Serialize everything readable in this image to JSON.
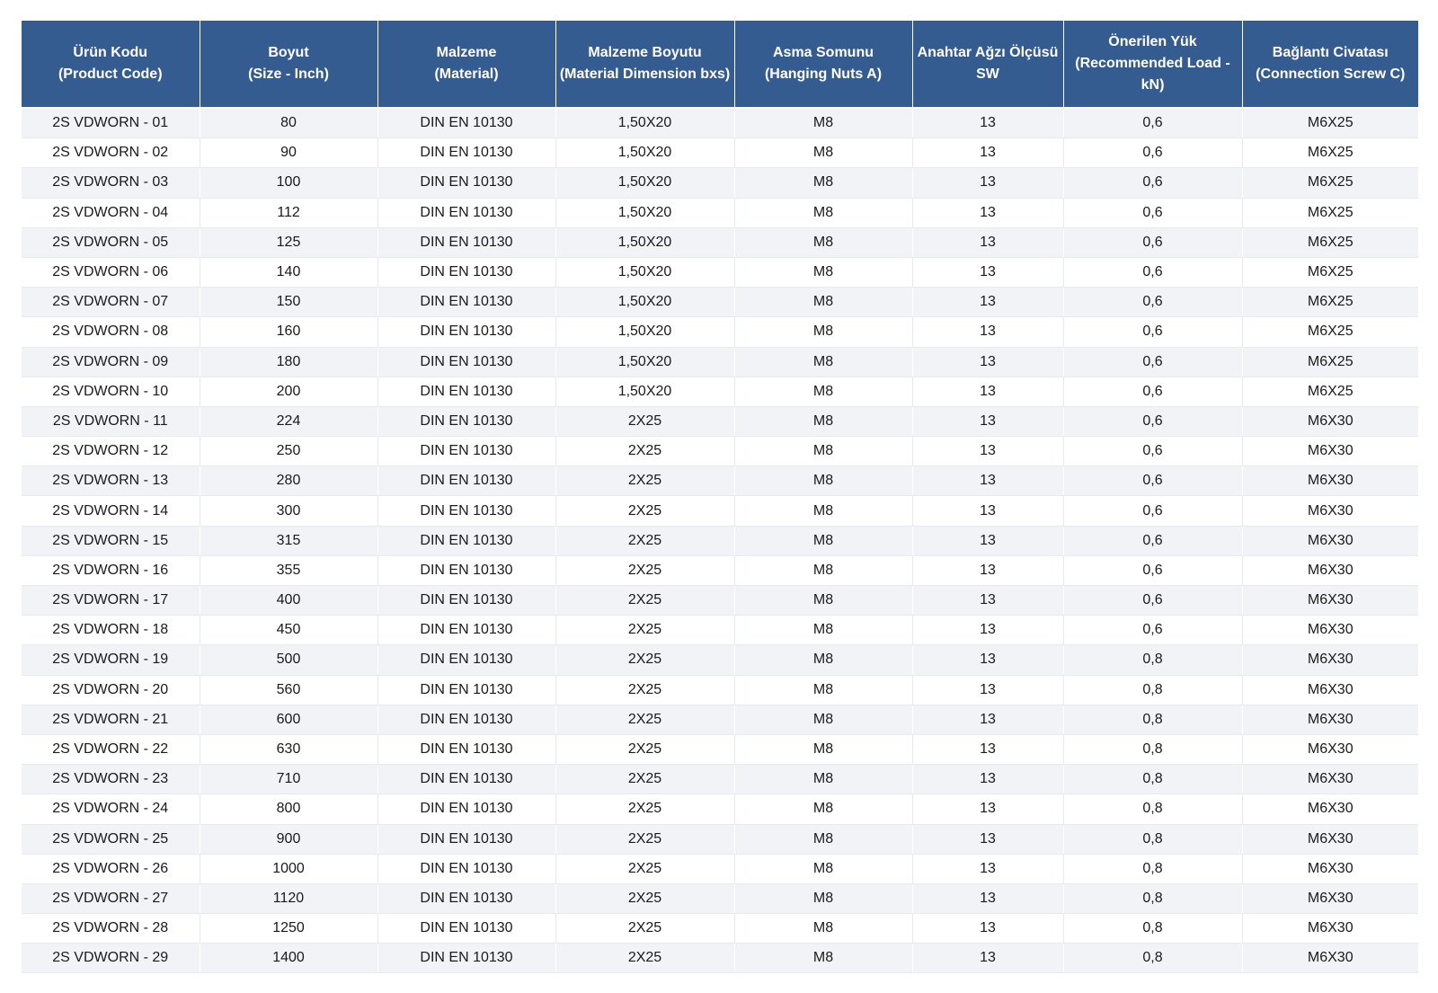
{
  "table": {
    "columns": [
      {
        "tr": "Ürün Kodu",
        "en": "(Product Code)"
      },
      {
        "tr": "Boyut",
        "en": "(Size - Inch)"
      },
      {
        "tr": "Malzeme",
        "en": "(Material)"
      },
      {
        "tr": "Malzeme Boyutu",
        "en": "(Material Dimension bxs)"
      },
      {
        "tr": "Asma Somunu",
        "en": "(Hanging Nuts A)"
      },
      {
        "tr": "Anahtar Ağzı Ölçüsü",
        "en": "SW"
      },
      {
        "tr": "Önerilen Yük",
        "en": "(Recommended Load - kN)"
      },
      {
        "tr": "Bağlantı Civatası",
        "en": "(Connection Screw C)"
      }
    ],
    "rows": [
      [
        "2S VDWORN - 01",
        "80",
        "DIN EN 10130",
        "1,50X20",
        "M8",
        "13",
        "0,6",
        "M6X25"
      ],
      [
        "2S VDWORN - 02",
        "90",
        "DIN EN 10130",
        "1,50X20",
        "M8",
        "13",
        "0,6",
        "M6X25"
      ],
      [
        "2S VDWORN - 03",
        "100",
        "DIN EN 10130",
        "1,50X20",
        "M8",
        "13",
        "0,6",
        "M6X25"
      ],
      [
        "2S VDWORN - 04",
        "112",
        "DIN EN 10130",
        "1,50X20",
        "M8",
        "13",
        "0,6",
        "M6X25"
      ],
      [
        "2S VDWORN - 05",
        "125",
        "DIN EN 10130",
        "1,50X20",
        "M8",
        "13",
        "0,6",
        "M6X25"
      ],
      [
        "2S VDWORN - 06",
        "140",
        "DIN EN 10130",
        "1,50X20",
        "M8",
        "13",
        "0,6",
        "M6X25"
      ],
      [
        "2S VDWORN - 07",
        "150",
        "DIN EN 10130",
        "1,50X20",
        "M8",
        "13",
        "0,6",
        "M6X25"
      ],
      [
        "2S VDWORN - 08",
        "160",
        "DIN EN 10130",
        "1,50X20",
        "M8",
        "13",
        "0,6",
        "M6X25"
      ],
      [
        "2S VDWORN - 09",
        "180",
        "DIN EN 10130",
        "1,50X20",
        "M8",
        "13",
        "0,6",
        "M6X25"
      ],
      [
        "2S VDWORN - 10",
        "200",
        "DIN EN 10130",
        "1,50X20",
        "M8",
        "13",
        "0,6",
        "M6X25"
      ],
      [
        "2S VDWORN - 11",
        "224",
        "DIN EN 10130",
        "2X25",
        "M8",
        "13",
        "0,6",
        "M6X30"
      ],
      [
        "2S VDWORN - 12",
        "250",
        "DIN EN 10130",
        "2X25",
        "M8",
        "13",
        "0,6",
        "M6X30"
      ],
      [
        "2S VDWORN - 13",
        "280",
        "DIN EN 10130",
        "2X25",
        "M8",
        "13",
        "0,6",
        "M6X30"
      ],
      [
        "2S VDWORN - 14",
        "300",
        "DIN EN 10130",
        "2X25",
        "M8",
        "13",
        "0,6",
        "M6X30"
      ],
      [
        "2S VDWORN - 15",
        "315",
        "DIN EN 10130",
        "2X25",
        "M8",
        "13",
        "0,6",
        "M6X30"
      ],
      [
        "2S VDWORN - 16",
        "355",
        "DIN EN 10130",
        "2X25",
        "M8",
        "13",
        "0,6",
        "M6X30"
      ],
      [
        "2S VDWORN - 17",
        "400",
        "DIN EN 10130",
        "2X25",
        "M8",
        "13",
        "0,6",
        "M6X30"
      ],
      [
        "2S VDWORN - 18",
        "450",
        "DIN EN 10130",
        "2X25",
        "M8",
        "13",
        "0,6",
        "M6X30"
      ],
      [
        "2S VDWORN - 19",
        "500",
        "DIN EN 10130",
        "2X25",
        "M8",
        "13",
        "0,8",
        "M6X30"
      ],
      [
        "2S VDWORN - 20",
        "560",
        "DIN EN 10130",
        "2X25",
        "M8",
        "13",
        "0,8",
        "M6X30"
      ],
      [
        "2S VDWORN - 21",
        "600",
        "DIN EN 10130",
        "2X25",
        "M8",
        "13",
        "0,8",
        "M6X30"
      ],
      [
        "2S VDWORN - 22",
        "630",
        "DIN EN 10130",
        "2X25",
        "M8",
        "13",
        "0,8",
        "M6X30"
      ],
      [
        "2S VDWORN - 23",
        "710",
        "DIN EN 10130",
        "2X25",
        "M8",
        "13",
        "0,8",
        "M6X30"
      ],
      [
        "2S VDWORN - 24",
        "800",
        "DIN EN 10130",
        "2X25",
        "M8",
        "13",
        "0,8",
        "M6X30"
      ],
      [
        "2S VDWORN - 25",
        "900",
        "DIN EN 10130",
        "2X25",
        "M8",
        "13",
        "0,8",
        "M6X30"
      ],
      [
        "2S VDWORN - 26",
        "1000",
        "DIN EN 10130",
        "2X25",
        "M8",
        "13",
        "0,8",
        "M6X30"
      ],
      [
        "2S VDWORN - 27",
        "1120",
        "DIN EN 10130",
        "2X25",
        "M8",
        "13",
        "0,8",
        "M6X30"
      ],
      [
        "2S VDWORN - 28",
        "1250",
        "DIN EN 10130",
        "2X25",
        "M8",
        "13",
        "0,8",
        "M6X30"
      ],
      [
        "2S VDWORN - 29",
        "1400",
        "DIN EN 10130",
        "2X25",
        "M8",
        "13",
        "0,8",
        "M6X30"
      ]
    ]
  },
  "colors": {
    "header_bg": "#355c91",
    "header_text": "#ffffff",
    "row_alt": "#f1f3f7",
    "row": "#ffffff"
  }
}
